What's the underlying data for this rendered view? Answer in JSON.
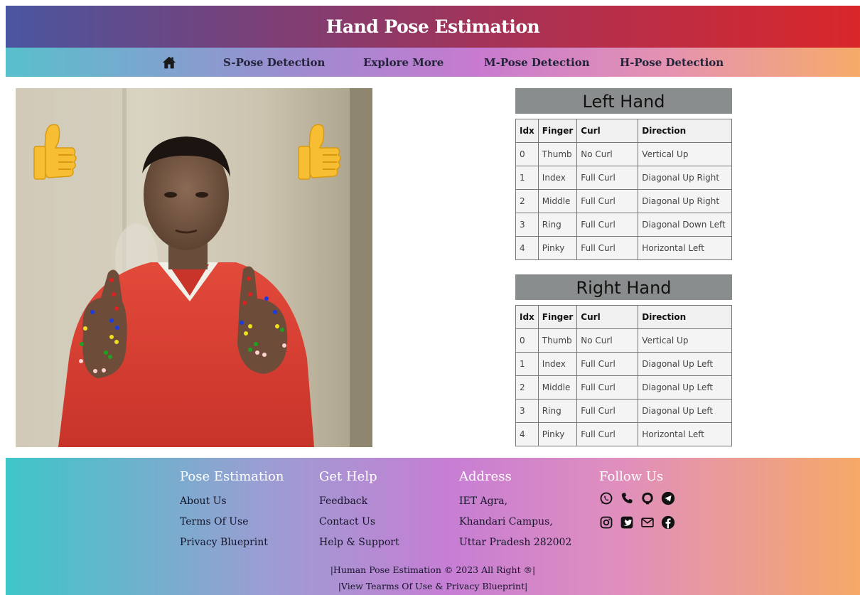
{
  "header": {
    "title": "Hand Pose Estimation"
  },
  "nav": {
    "home_icon": "home-icon",
    "items": [
      {
        "label": "S-Pose Detection"
      },
      {
        "label": "Explore More"
      },
      {
        "label": "M-Pose Detection"
      },
      {
        "label": "H-Pose Detection"
      }
    ]
  },
  "left_hand": {
    "title": "Left Hand",
    "columns": [
      "Idx",
      "Finger",
      "Curl",
      "Direction"
    ],
    "rows": [
      [
        "0",
        "Thumb",
        "No Curl",
        "Vertical Up"
      ],
      [
        "1",
        "Index",
        "Full Curl",
        "Diagonal Up Right"
      ],
      [
        "2",
        "Middle",
        "Full Curl",
        "Diagonal Up Right"
      ],
      [
        "3",
        "Ring",
        "Full Curl",
        "Diagonal Down Left"
      ],
      [
        "4",
        "Pinky",
        "Full Curl",
        "Horizontal Left"
      ]
    ]
  },
  "right_hand": {
    "title": "Right Hand",
    "columns": [
      "Idx",
      "Finger",
      "Curl",
      "Direction"
    ],
    "rows": [
      [
        "0",
        "Thumb",
        "No Curl",
        "Vertical Up"
      ],
      [
        "1",
        "Index",
        "Full Curl",
        "Diagonal Up Left"
      ],
      [
        "2",
        "Middle",
        "Full Curl",
        "Diagonal Up Left"
      ],
      [
        "3",
        "Ring",
        "Full Curl",
        "Diagonal Up Left"
      ],
      [
        "4",
        "Pinky",
        "Full Curl",
        "Horizontal Left"
      ]
    ]
  },
  "footer": {
    "pose": {
      "heading": "Pose Estimation",
      "links": [
        "About Us",
        "Terms Of Use",
        "Privacy Blueprint"
      ]
    },
    "help": {
      "heading": "Get Help",
      "links": [
        "Feedback",
        "Contact Us",
        "Help & Support"
      ]
    },
    "address": {
      "heading": "Address",
      "lines": [
        "IET Agra,",
        "Khandari Campus,",
        "Uttar Pradesh 282002"
      ]
    },
    "follow": {
      "heading": "Follow Us",
      "row1": [
        "whatsapp-icon",
        "phone-icon",
        "github-icon",
        "telegram-icon"
      ],
      "row2": [
        "instagram-icon",
        "twitter-icon",
        "mail-icon",
        "facebook-icon"
      ]
    },
    "copyright": "|Human Pose Estimation © 2023 All Right ®|",
    "terms_line": "|View Tearms Of Use & Privacy Blueprint|"
  },
  "colors": {
    "header_start": "#4a56a0",
    "header_end": "#d9272a",
    "nav_start": "#58c0cc",
    "nav_end": "#f6ab6a",
    "table_title_bg": "#8a8d8d"
  }
}
